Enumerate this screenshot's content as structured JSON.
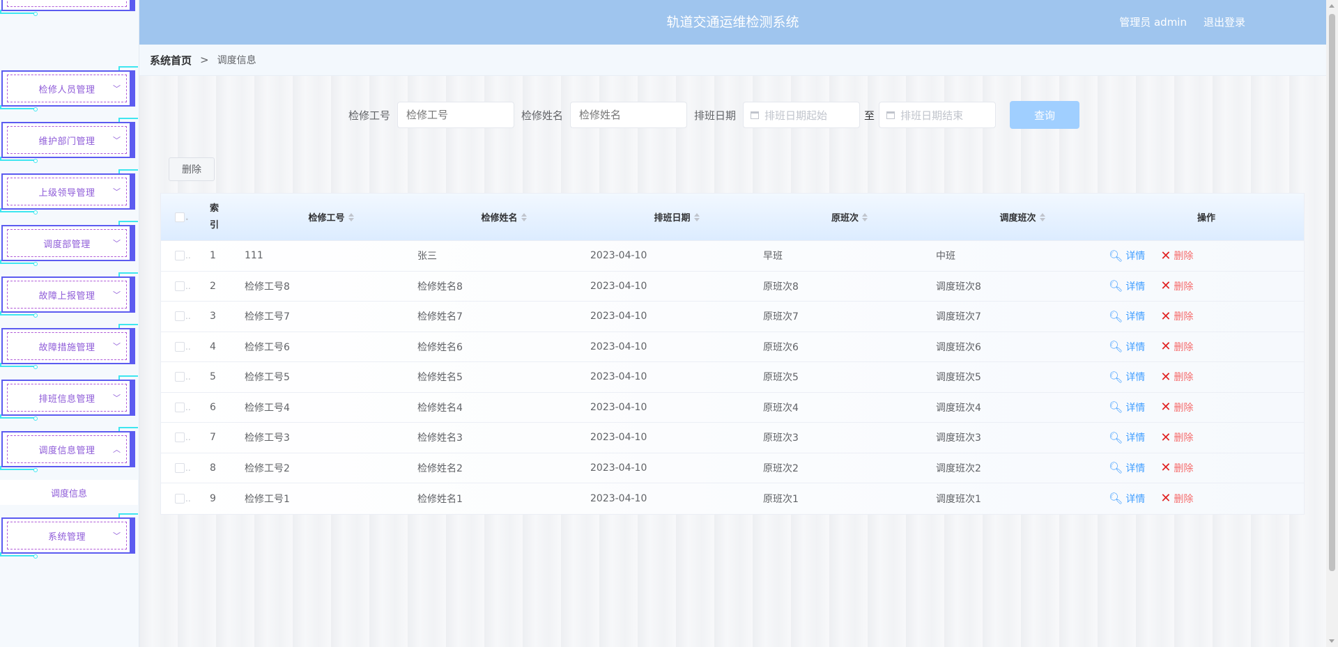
{
  "header": {
    "title": "轨道交通运维检测系统",
    "user_label": "管理员 admin",
    "logout_label": "退出登录"
  },
  "sidebar": {
    "items": [
      {
        "label": "",
        "expanded": false
      },
      {
        "label": "检修人员管理",
        "expanded": false
      },
      {
        "label": "维护部门管理",
        "expanded": false
      },
      {
        "label": "上级领导管理",
        "expanded": false
      },
      {
        "label": "调度部管理",
        "expanded": false
      },
      {
        "label": "故障上报管理",
        "expanded": false
      },
      {
        "label": "故障措施管理",
        "expanded": false
      },
      {
        "label": "排班信息管理",
        "expanded": false
      },
      {
        "label": "调度信息管理",
        "expanded": true
      },
      {
        "label": "系统管理",
        "expanded": false
      }
    ],
    "sub_item": "调度信息",
    "chevron_down": "﹀",
    "chevron_up": "︿"
  },
  "breadcrumb": {
    "home": "系统首页",
    "separator": ">",
    "current": "调度信息"
  },
  "search": {
    "no_label": "检修工号",
    "no_placeholder": "检修工号",
    "name_label": "检修姓名",
    "name_placeholder": "检修姓名",
    "date_label": "排班日期",
    "date_start_placeholder": "排班日期起始",
    "to_label": "至",
    "date_end_placeholder": "排班日期结束",
    "query_label": "查询"
  },
  "toolbar": {
    "delete_label": "删除"
  },
  "table": {
    "headers": {
      "index": "索引",
      "no": "检修工号",
      "name": "检修姓名",
      "date": "排班日期",
      "orig": "原班次",
      "adj": "调度班次",
      "op": "操作"
    },
    "detail_label": "详情",
    "delete_label": "删除",
    "rows": [
      {
        "index": "1",
        "no": "111",
        "name": "张三",
        "date": "2023-04-10",
        "orig": "早班",
        "adj": "中班"
      },
      {
        "index": "2",
        "no": "检修工号8",
        "name": "检修姓名8",
        "date": "2023-04-10",
        "orig": "原班次8",
        "adj": "调度班次8"
      },
      {
        "index": "3",
        "no": "检修工号7",
        "name": "检修姓名7",
        "date": "2023-04-10",
        "orig": "原班次7",
        "adj": "调度班次7"
      },
      {
        "index": "4",
        "no": "检修工号6",
        "name": "检修姓名6",
        "date": "2023-04-10",
        "orig": "原班次6",
        "adj": "调度班次6"
      },
      {
        "index": "5",
        "no": "检修工号5",
        "name": "检修姓名5",
        "date": "2023-04-10",
        "orig": "原班次5",
        "adj": "调度班次5"
      },
      {
        "index": "6",
        "no": "检修工号4",
        "name": "检修姓名4",
        "date": "2023-04-10",
        "orig": "原班次4",
        "adj": "调度班次4"
      },
      {
        "index": "7",
        "no": "检修工号3",
        "name": "检修姓名3",
        "date": "2023-04-10",
        "orig": "原班次3",
        "adj": "调度班次3"
      },
      {
        "index": "8",
        "no": "检修工号2",
        "name": "检修姓名2",
        "date": "2023-04-10",
        "orig": "原班次2",
        "adj": "调度班次2"
      },
      {
        "index": "9",
        "no": "检修工号1",
        "name": "检修姓名1",
        "date": "2023-04-10",
        "orig": "原班次1",
        "adj": "调度班次1"
      }
    ]
  },
  "colors": {
    "header_bg": "#9fc5ee",
    "menu_border": "#5b5bf0",
    "menu_text": "#8e5bd8",
    "trace": "#3ee6f0",
    "primary": "#409eff",
    "danger": "#e02020"
  }
}
